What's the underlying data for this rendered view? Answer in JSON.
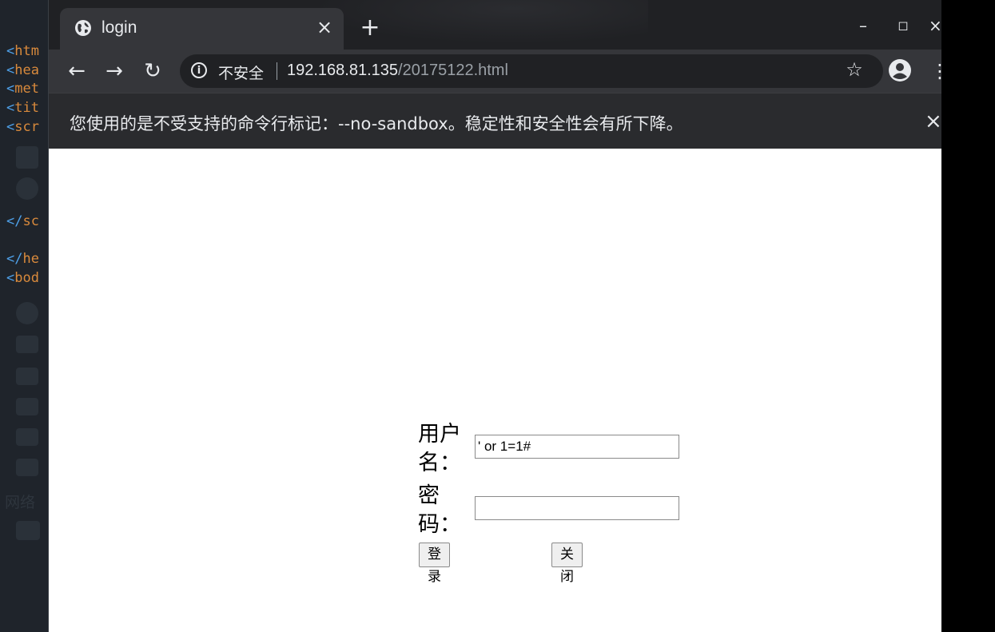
{
  "editor": {
    "code_lines": [
      {
        "bracket": "<",
        "tag": "htm"
      },
      {
        "bracket": "<",
        "tag": "hea"
      },
      {
        "bracket": "<",
        "tag": "met"
      },
      {
        "bracket": "<",
        "tag": "tit"
      },
      {
        "bracket": "<",
        "tag": "scr"
      },
      {
        "bracket": "</",
        "tag": "sc"
      },
      {
        "bracket": "</",
        "tag": "he"
      },
      {
        "bracket": "<",
        "tag": "bod"
      }
    ],
    "faded_label": "网络"
  },
  "browser": {
    "tab": {
      "title": "login",
      "close_glyph": "×"
    },
    "new_tab_glyph": "+",
    "window_controls": {
      "minimize": "–",
      "maximize": "◻",
      "close": "×"
    },
    "toolbar": {
      "back_glyph": "←",
      "forward_glyph": "→",
      "reload_glyph": "↻",
      "security_text": "不安全",
      "url_host": "192.168.81.135",
      "url_path": "/20175122.html",
      "bookmark_glyph": "☆",
      "menu_glyph": "⋮"
    },
    "infobar": {
      "message": "您使用的是不受支持的命令行标记：--no-sandbox。稳定性和安全性会有所下降。",
      "close_glyph": "×"
    }
  },
  "login_form": {
    "username_label_1": "用户",
    "username_label_2": "名：",
    "username_value": "' or 1=1#",
    "password_label_1": "密",
    "password_label_2": "码：",
    "password_value": "",
    "login_button": "登录",
    "close_button": "关闭"
  },
  "colors": {
    "titlebar": "#202124",
    "toolbar": "#35363a",
    "infobar": "#2a2b2e",
    "editor_bg": "#1f242b",
    "tag_orange": "#d98a3c",
    "bracket_blue": "#4ea0e8"
  },
  "icons": [
    "globe-icon",
    "info-icon",
    "star-icon",
    "profile-icon",
    "kebab-menu-icon"
  ]
}
